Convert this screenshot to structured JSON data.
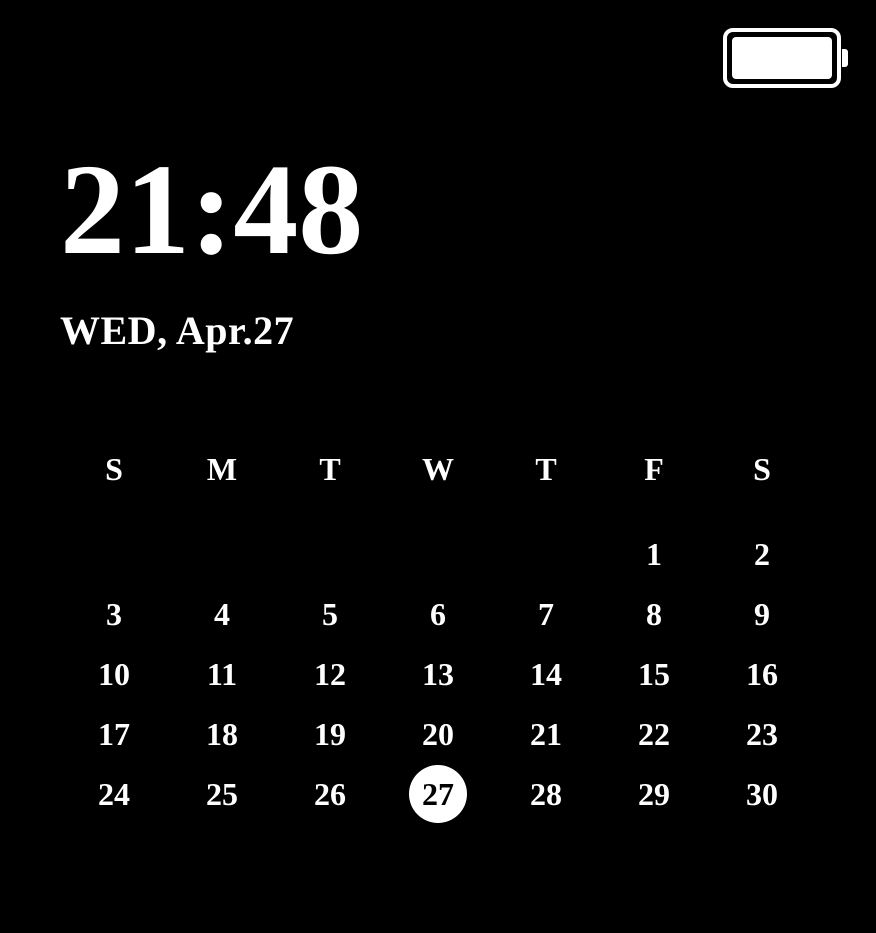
{
  "battery": {
    "level": 100
  },
  "clock": {
    "time": "21:48",
    "date": "WED, Apr.27"
  },
  "calendar": {
    "weekdays": [
      "S",
      "M",
      "T",
      "W",
      "T",
      "F",
      "S"
    ],
    "weeks": [
      [
        "",
        "",
        "",
        "",
        "",
        "1",
        "2"
      ],
      [
        "3",
        "4",
        "5",
        "6",
        "7",
        "8",
        "9"
      ],
      [
        "10",
        "11",
        "12",
        "13",
        "14",
        "15",
        "16"
      ],
      [
        "17",
        "18",
        "19",
        "20",
        "21",
        "22",
        "23"
      ],
      [
        "24",
        "25",
        "26",
        "27",
        "28",
        "29",
        "30"
      ]
    ],
    "today": "27"
  }
}
